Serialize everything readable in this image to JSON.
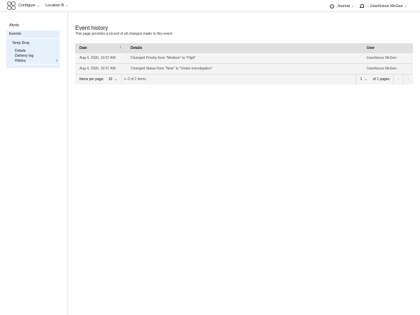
{
  "header": {
    "configure_label": "Configure",
    "location_label": "Location B",
    "journal_label": "Journal",
    "user_name": "Userlicious McGee"
  },
  "sidebar": {
    "alerts": "Alerts",
    "events": "Events",
    "temp_drop": "Temp Drop",
    "details": "Details",
    "delivery_log": "Delivery log",
    "history": "History"
  },
  "page": {
    "title": "Event history",
    "subtitle": "This page provides a record of all changes made to this event."
  },
  "table": {
    "headers": {
      "date": "Date",
      "details": "Details",
      "user": "User"
    },
    "rows": [
      {
        "date": "Aug 4, 2026, 10:57 AM",
        "details": "Changed Priority from \"Medium\" to \"High\"",
        "user": "Userlicious McGee"
      },
      {
        "date": "Aug 4, 2026, 10:57 AM",
        "details": "Changed Status from \"New\" to \"Under investigation\"",
        "user": "Userlicious McGee"
      }
    ]
  },
  "pagination": {
    "items_per_page_label": "Items per page:",
    "items_per_page_value": "10",
    "range_text": "1–2 of 2 items",
    "current_page": "1",
    "of_pages_text": "of 1 pages"
  }
}
